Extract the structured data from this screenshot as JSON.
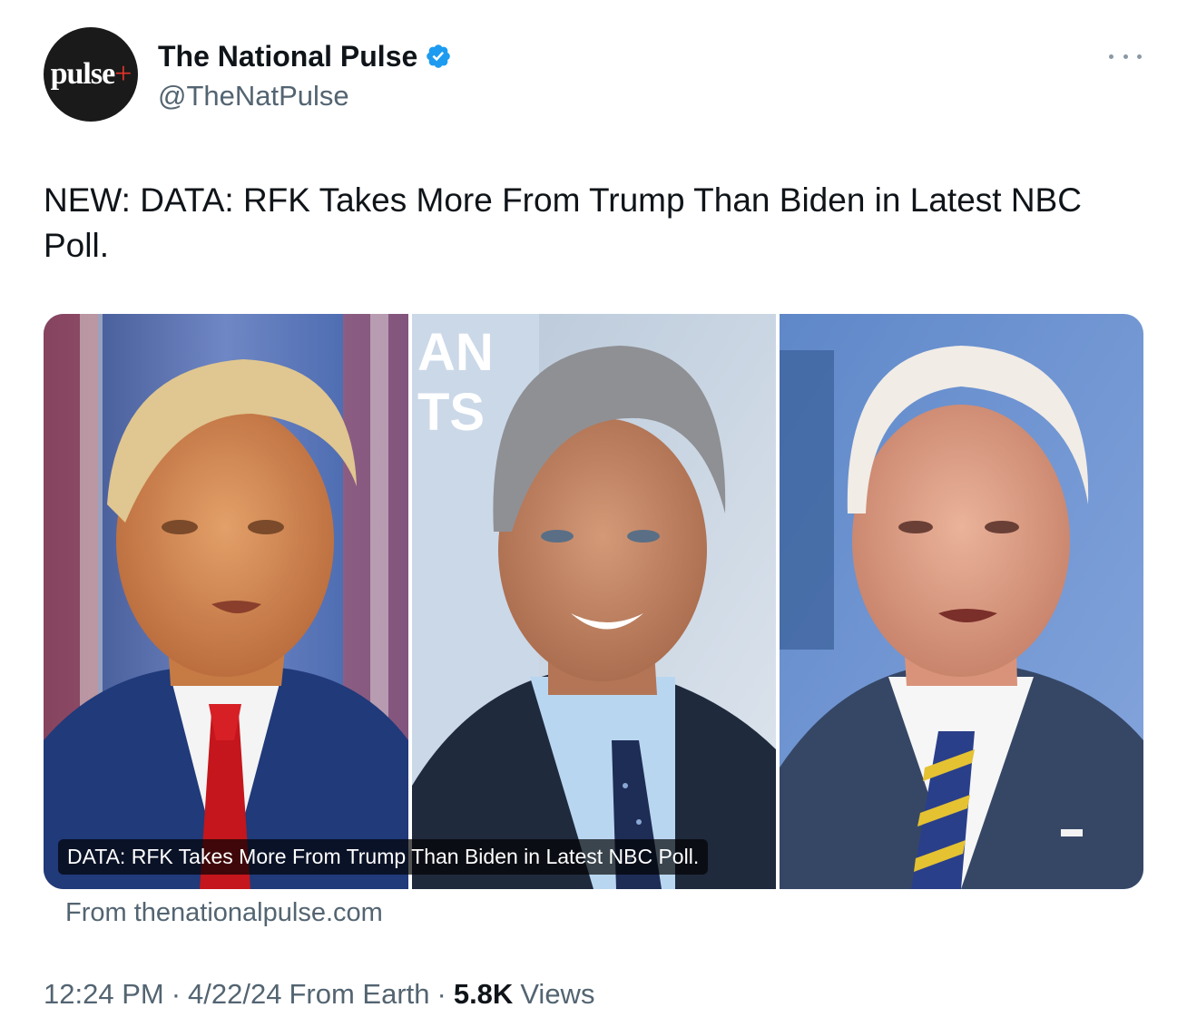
{
  "author": {
    "avatar_text": "pulse",
    "avatar_plus": "+",
    "display_name": "The National Pulse",
    "handle": "@TheNatPulse",
    "verified": true,
    "verified_color": "#1d9bf0"
  },
  "tweet": {
    "text": "NEW: DATA: RFK Takes More From Trump Than Biden in Latest NBC Poll."
  },
  "card": {
    "caption": "DATA: RFK Takes More From Trump Than Biden in Latest NBC Poll.",
    "source": "From thenationalpulse.com",
    "panel_backdrop_text_line1": "AN",
    "panel_backdrop_text_line2": "TS"
  },
  "meta": {
    "time": "12:24 PM",
    "sep1": "·",
    "date": "4/22/24",
    "client": "From Earth",
    "sep2": "·",
    "views_count": "5.8K",
    "views_label": "Views"
  },
  "icons": {
    "more": "more-horizontal-icon",
    "verified": "verified-badge-icon"
  },
  "colors": {
    "text_primary": "#0f1419",
    "text_secondary": "#536471",
    "accent": "#1d9bf0",
    "avatar_bg": "#1a1a1a",
    "avatar_plus": "#e2342a"
  }
}
